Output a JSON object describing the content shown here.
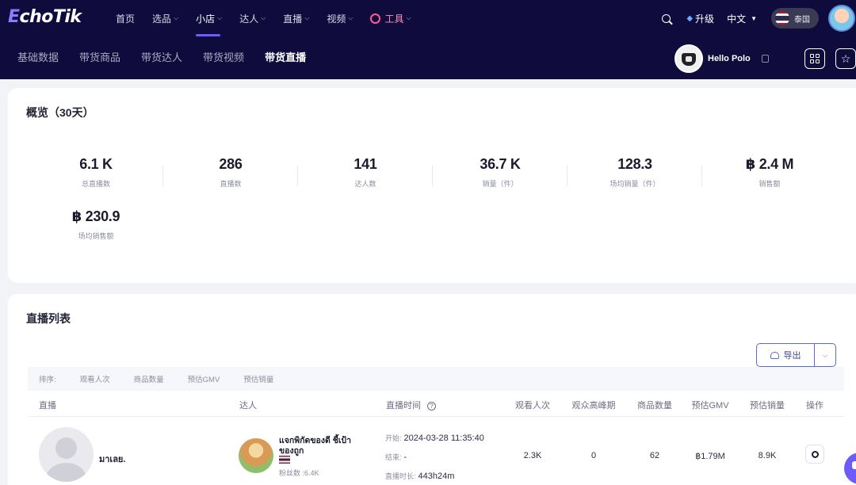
{
  "header": {
    "logo_prefix": "E",
    "logo_rest": "choTik",
    "nav": [
      {
        "label": "首页",
        "has_dropdown": false,
        "active": false
      },
      {
        "label": "选品",
        "has_dropdown": true,
        "active": false
      },
      {
        "label": "小店",
        "has_dropdown": true,
        "active": true
      },
      {
        "label": "达人",
        "has_dropdown": true,
        "active": false
      },
      {
        "label": "直播",
        "has_dropdown": true,
        "active": false
      },
      {
        "label": "视频",
        "has_dropdown": true,
        "active": false
      },
      {
        "label": "工具",
        "has_dropdown": true,
        "active": false
      }
    ],
    "upgrade_label": "升级",
    "language": "中文",
    "country": "泰国",
    "accent_color": "#6c5cff",
    "bg_color": "#0f0c3d"
  },
  "subnav": {
    "tabs": [
      "基础数据",
      "带货商品",
      "带货达人",
      "带货视频",
      "带货直播"
    ],
    "active_index": 4
  },
  "shop": {
    "name": "Hello Polo"
  },
  "overview": {
    "title": "概览（30天）",
    "metrics": [
      {
        "value": "6.1 K",
        "label": "总直播数"
      },
      {
        "value": "286",
        "label": "直播数"
      },
      {
        "value": "141",
        "label": "达人数"
      },
      {
        "value": "36.7 K",
        "label": "销量（件）"
      },
      {
        "value": "128.3",
        "label": "场均销量（件）"
      },
      {
        "value": "฿ 2.4 M",
        "label": "销售额"
      },
      {
        "value": "฿ 230.9",
        "label": "场均销售额"
      }
    ]
  },
  "live_list": {
    "title": "直播列表",
    "export_label": "导出",
    "sort_label": "排序:",
    "sort_options": [
      "观看人次",
      "商品数量",
      "预估GMV",
      "预估销量"
    ],
    "columns": [
      "直播",
      "达人",
      "直播时间",
      "观看人次",
      "观众高峰期",
      "商品数量",
      "预估GMV",
      "预估销量",
      "操作"
    ],
    "rows": [
      {
        "live_name": "มาเลย.",
        "influencer_name": "แจกพิกัดของดี ชี้เป้าของถูก",
        "fans_label": "粉丝数 :",
        "fans": "6.4K",
        "start_label": "开始:",
        "start": "2024-03-28 11:35:40",
        "end_label": "结束:",
        "end": "-",
        "duration_label": "直播时长:",
        "duration": "443h24m",
        "views": "2.3K",
        "peak": "0",
        "products": "62",
        "gmv": "฿1.79M",
        "sales": "8.9K"
      }
    ]
  }
}
